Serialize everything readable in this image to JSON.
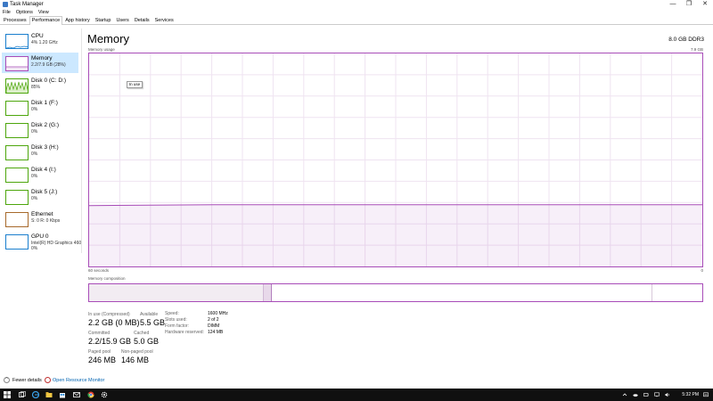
{
  "window": {
    "title": "Task Manager",
    "controls": {
      "minimize": "—",
      "restore": "❐",
      "close": "✕"
    }
  },
  "menu": [
    "File",
    "Options",
    "View"
  ],
  "tabs": [
    "Processes",
    "Performance",
    "App history",
    "Startup",
    "Users",
    "Details",
    "Services"
  ],
  "active_tab": "Performance",
  "sidebar": [
    {
      "name": "CPU",
      "sub": "4%  1.20 GHz",
      "sub2": "",
      "color": "#1b7fce",
      "selected": false
    },
    {
      "name": "Memory",
      "sub": "2.2/7.9 GB (28%)",
      "sub2": "",
      "color": "#a84cb8",
      "selected": true
    },
    {
      "name": "Disk 0 (C: D:)",
      "sub": "85%",
      "sub2": "",
      "color": "#4da60c",
      "selected": false
    },
    {
      "name": "Disk 1 (F:)",
      "sub": "0%",
      "sub2": "",
      "color": "#4da60c",
      "selected": false
    },
    {
      "name": "Disk 2 (G:)",
      "sub": "0%",
      "sub2": "",
      "color": "#4da60c",
      "selected": false
    },
    {
      "name": "Disk 3 (H:)",
      "sub": "0%",
      "sub2": "",
      "color": "#4da60c",
      "selected": false
    },
    {
      "name": "Disk 4 (I:)",
      "sub": "0%",
      "sub2": "",
      "color": "#4da60c",
      "selected": false
    },
    {
      "name": "Disk 5 (J:)",
      "sub": "0%",
      "sub2": "",
      "color": "#4da60c",
      "selected": false
    },
    {
      "name": "Ethernet",
      "sub": "S: 0  R: 0 Kbps",
      "sub2": "",
      "color": "#a7692b",
      "selected": false
    },
    {
      "name": "GPU 0",
      "sub": "Intel(R) HD Graphics 460",
      "sub2": "0%",
      "color": "#1b7fce",
      "selected": false
    }
  ],
  "main": {
    "title": "Memory",
    "capacity": "8.0 GB DDR3",
    "usage_label": "Memory usage",
    "usage_max": "7.9 GB",
    "time_left": "60 seconds",
    "time_right": "0",
    "composition_label": "Memory composition",
    "tooltip": "In use",
    "usage_fraction": 0.29,
    "accent": "#a84cb8"
  },
  "stats": {
    "in_use_label": "In use (Compressed)",
    "in_use_value": "2.2 GB (0 MB)",
    "available_label": "Available",
    "available_value": "5.5 GB",
    "committed_label": "Committed",
    "committed_value": "2.2/15.9 GB",
    "cached_label": "Cached",
    "cached_value": "5.0 GB",
    "paged_label": "Paged pool",
    "paged_value": "246 MB",
    "nonpaged_label": "Non-paged pool",
    "nonpaged_value": "146 MB"
  },
  "details": [
    {
      "key": "Speed:",
      "value": "1600 MHz"
    },
    {
      "key": "Slots used:",
      "value": "2 of 2"
    },
    {
      "key": "Form factor:",
      "value": "DIMM"
    },
    {
      "key": "Hardware reserved:",
      "value": "124 MB"
    }
  ],
  "footer": {
    "fewer_details": "Fewer details",
    "open_resmon": "Open Resource Monitor"
  },
  "taskbar": {
    "clock": "5:32 PM"
  }
}
